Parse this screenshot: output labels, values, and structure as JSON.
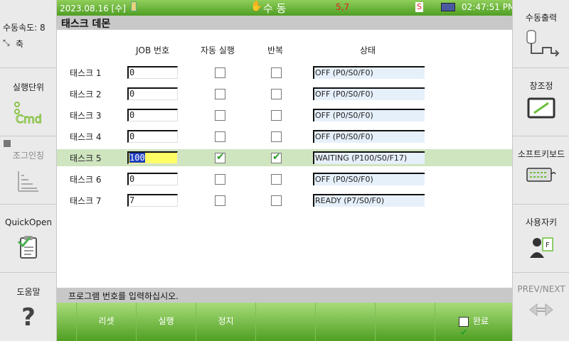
{
  "left_panel": {
    "speed_label": "수동속도: 8",
    "axis_label": "축",
    "exec_unit_label": "실행단위",
    "jog_label": "조그인칭",
    "quickopen_label": "QuickOpen",
    "help_label": "도움말"
  },
  "right_panel": {
    "manual_output_label": "수동출력",
    "window_adjust_label": "창조정",
    "soft_keyboard_label": "소프트키보드",
    "user_key_label": "사용자키",
    "prev_next_label": "PREV/NEXT"
  },
  "status_bar": {
    "datetime": "2023.08.16 [수]",
    "mode": "수      동",
    "position": "5,7",
    "s_badge": "S",
    "time": "02:47:51 PM"
  },
  "title": "태스크 데몬",
  "table": {
    "headers": {
      "job": "JOB 번호",
      "auto": "자동 실행",
      "repeat": "반복",
      "status": "상태"
    },
    "rows": [
      {
        "name": "태스크 1",
        "job": "0",
        "auto": false,
        "repeat": false,
        "status": "OFF (P0/S0/F0)"
      },
      {
        "name": "태스크 2",
        "job": "0",
        "auto": false,
        "repeat": false,
        "status": "OFF (P0/S0/F0)"
      },
      {
        "name": "태스크 3",
        "job": "0",
        "auto": false,
        "repeat": false,
        "status": "OFF (P0/S0/F0)"
      },
      {
        "name": "태스크 4",
        "job": "0",
        "auto": false,
        "repeat": false,
        "status": "OFF (P0/S0/F0)"
      },
      {
        "name": "태스크 5",
        "job": "100",
        "auto": true,
        "repeat": true,
        "status": "WAITING (P100/S0/F17)"
      },
      {
        "name": "태스크 6",
        "job": "0",
        "auto": false,
        "repeat": false,
        "status": "OFF (P0/S0/F0)"
      },
      {
        "name": "태스크 7",
        "job": "7",
        "auto": false,
        "repeat": false,
        "status": "READY (P7/S0/F0)"
      }
    ]
  },
  "message": "프로그램 번호를 입력하십시오.",
  "bottom_buttons": {
    "reset": "리셋",
    "run": "실행",
    "stop": "정지",
    "done": "완료"
  },
  "colors": {
    "status_green": "#5fae30",
    "selected_row": "#cfe5c0",
    "status_field": "#e6f0fb",
    "input_highlight": "#ffff66"
  }
}
